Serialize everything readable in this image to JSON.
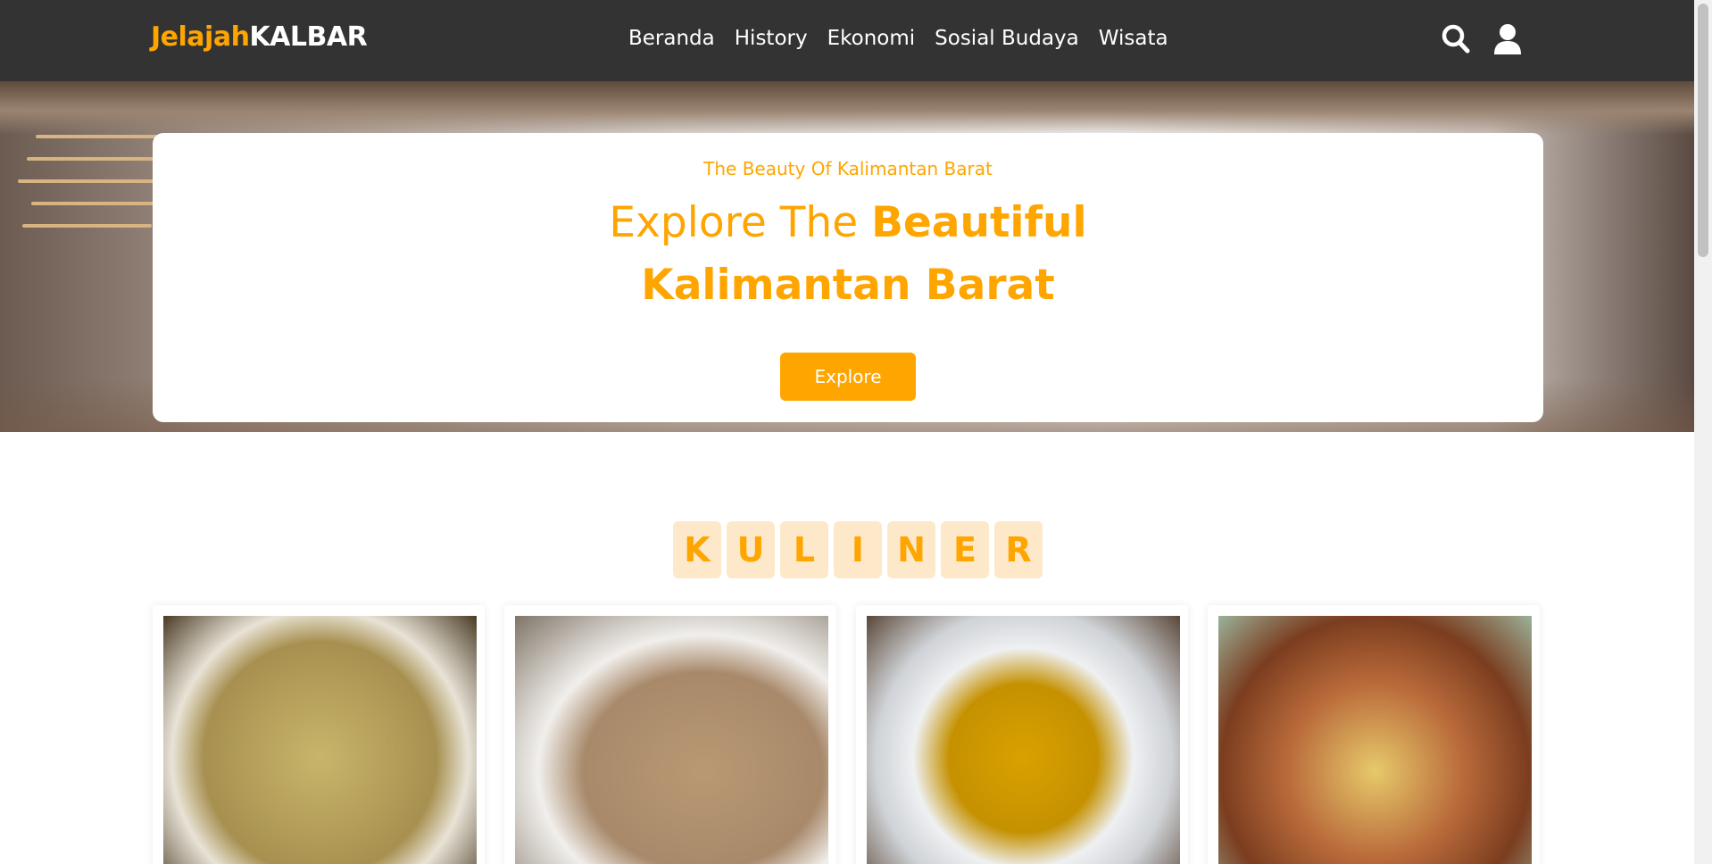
{
  "navbar": {
    "brand_part1": "Jelajah",
    "brand_part2": "KALBAR",
    "links": [
      "Beranda",
      "History",
      "Ekonomi",
      "Sosial Budaya",
      "Wisata"
    ],
    "icons": [
      "search-icon",
      "user-icon"
    ]
  },
  "hero": {
    "subtitle": "The Beauty Of Kalimantan Barat",
    "title_light": "Explore The ",
    "title_bold_line1": "Beautiful",
    "title_bold_line2": "Kalimantan Barat",
    "button_label": "Explore"
  },
  "section": {
    "letters": [
      "K",
      "U",
      "L",
      "I",
      "N",
      "E",
      "R"
    ]
  },
  "colors": {
    "accent": "#ffa500",
    "navbar_bg": "#333333",
    "tile_bg": "#fde9c9"
  }
}
